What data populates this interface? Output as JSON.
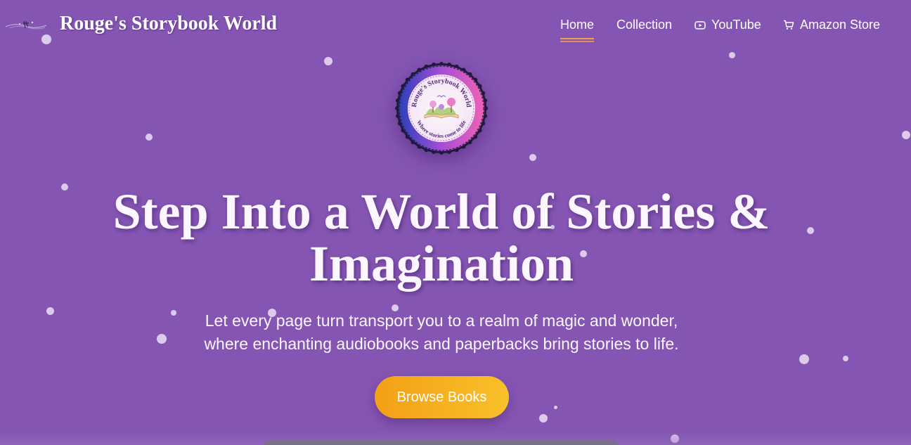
{
  "header": {
    "brand_title": "Rouge's Storybook World"
  },
  "nav": {
    "items": [
      {
        "label": "Home",
        "active": true
      },
      {
        "label": "Collection"
      },
      {
        "label": "YouTube",
        "icon": "play-icon"
      },
      {
        "label": "Amazon Store",
        "icon": "cart-icon"
      }
    ]
  },
  "badge": {
    "top_text": "Rouge's Storybook World",
    "bottom_text": "Where stories come to life"
  },
  "hero": {
    "title_line1": "Step Into a World of Stories &",
    "title_line2": "Imagination",
    "subtitle_line1": "Let every page turn transport you to a realm of magic and wonder,",
    "subtitle_line2": "where enchanting audiobooks and paperbacks bring stories to life.",
    "cta_label": "Browse Books"
  },
  "colors": {
    "background": "#8455b2",
    "cta_start": "#f3a016",
    "cta_end": "#f8c12a",
    "nav_underline": "#f2a441"
  }
}
